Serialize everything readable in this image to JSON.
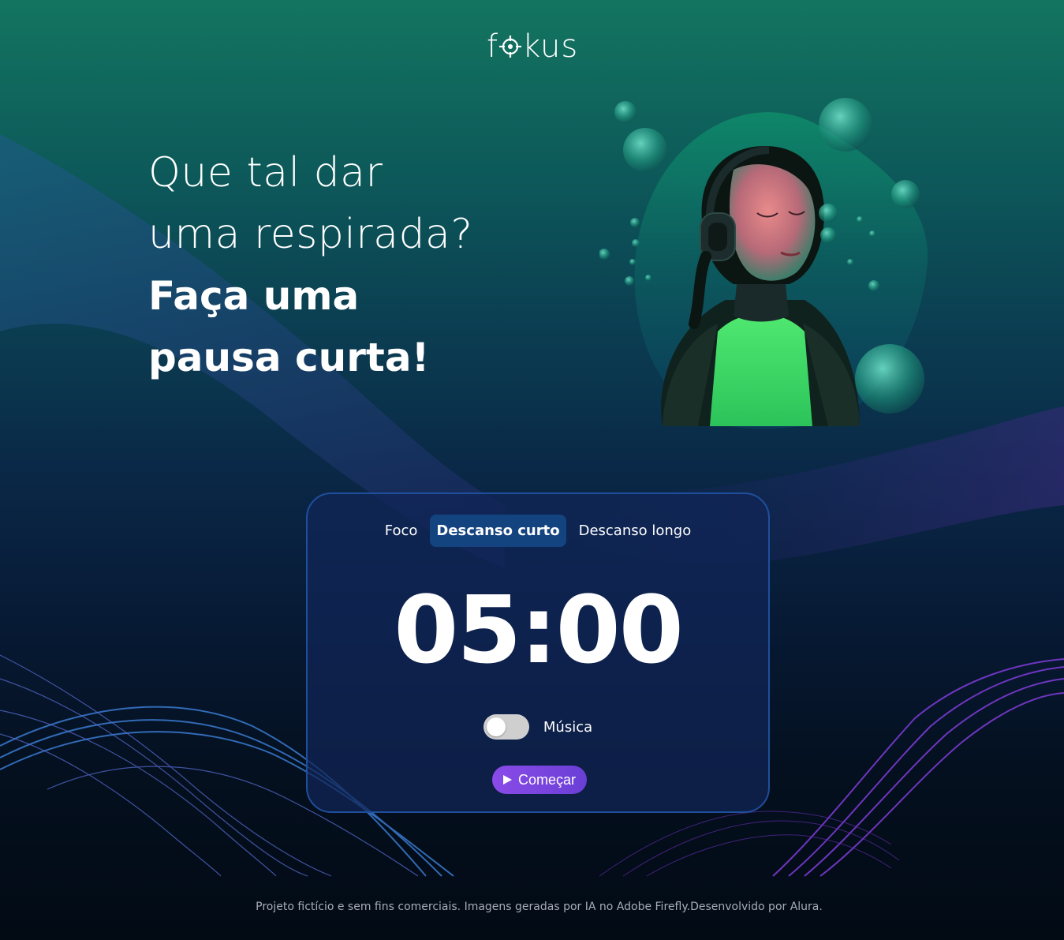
{
  "brand": {
    "logo_text_left": "f",
    "logo_text_right": "kus"
  },
  "headline": {
    "line1": "Que tal dar",
    "line2": "uma respirada?",
    "line3": "Faça uma",
    "line4": "pausa curta!"
  },
  "tabs": [
    {
      "label": "Foco",
      "active": false
    },
    {
      "label": "Descanso curto",
      "active": true
    },
    {
      "label": "Descanso longo",
      "active": false
    }
  ],
  "timer": {
    "display": "05:00"
  },
  "music": {
    "label": "Música",
    "enabled": false
  },
  "start_button": {
    "label": "Começar",
    "icon": "play-icon"
  },
  "footer": {
    "text": "Projeto fictício e sem fins comerciais. Imagens geradas por IA no Adobe Firefly.Desenvolvido por Alura."
  },
  "colors": {
    "accent": "#8a4be8",
    "active_tab": "#144480",
    "card_border": "#1f4f9c"
  }
}
